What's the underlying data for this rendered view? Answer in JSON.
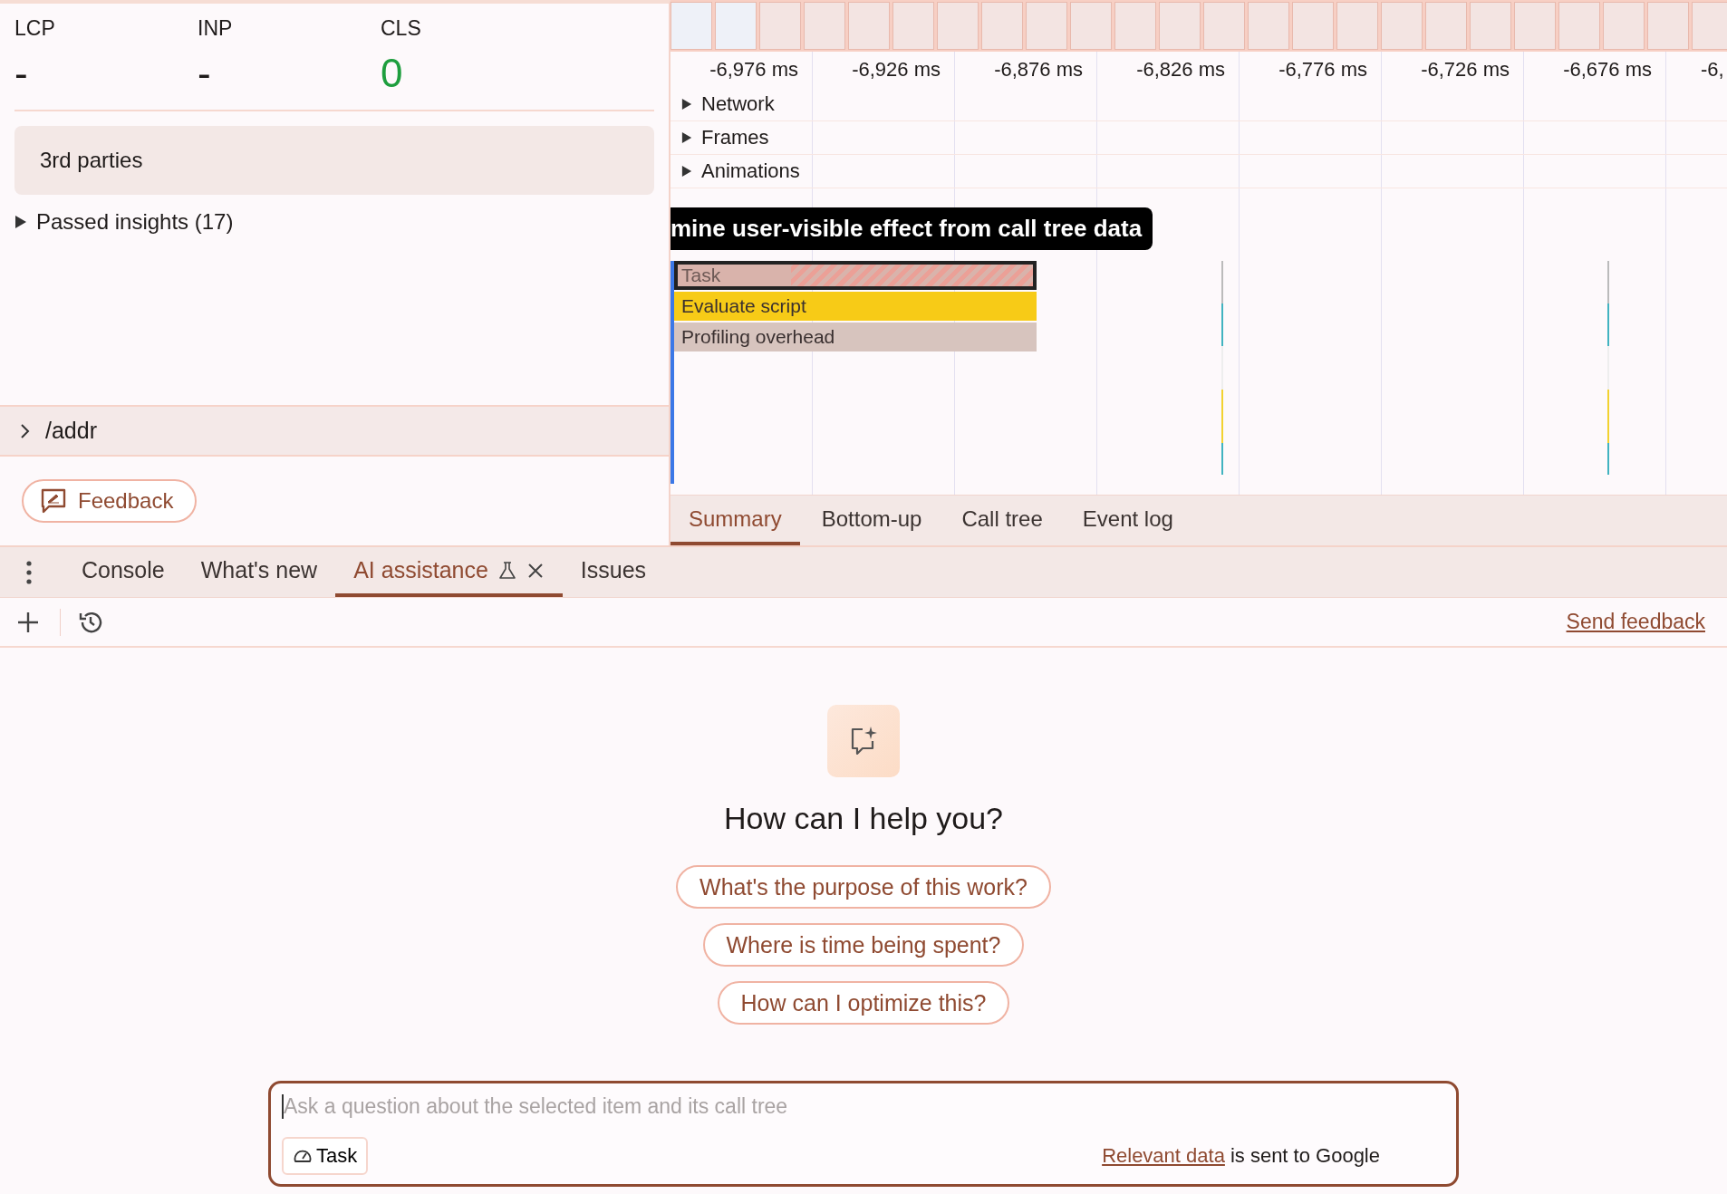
{
  "metrics": [
    {
      "label": "LCP",
      "value": "-",
      "color": "#1f1b1a"
    },
    {
      "label": "INP",
      "value": "-",
      "color": "#1f1b1a"
    },
    {
      "label": "CLS",
      "value": "0",
      "color": "#1e9e3e"
    }
  ],
  "insights": {
    "card": "3rd parties",
    "passed": {
      "label": "Passed insights (17)",
      "expanded": false
    }
  },
  "route": {
    "label": "/addr",
    "expanded": false
  },
  "feedback_button": "Feedback",
  "timeline": {
    "ticks": [
      "-6,976 ms",
      "-6,926 ms",
      "-6,876 ms",
      "-6,826 ms",
      "-6,776 ms",
      "-6,726 ms",
      "-6,676 ms",
      "-6,"
    ],
    "tracks": [
      {
        "label": "Network",
        "expanded": false
      },
      {
        "label": "Frames",
        "expanded": false
      },
      {
        "label": "Animations",
        "expanded": false
      }
    ],
    "tooltip": "mine user-visible effect from call tree data",
    "flame": [
      {
        "label": "Task",
        "kind": "task",
        "selected": true
      },
      {
        "label": "Evaluate script",
        "kind": "script",
        "selected": false
      },
      {
        "label": "Profiling overhead",
        "kind": "overhead",
        "selected": false
      }
    ]
  },
  "details_tabs": [
    {
      "label": "Summary",
      "selected": true
    },
    {
      "label": "Bottom-up",
      "selected": false
    },
    {
      "label": "Call tree",
      "selected": false
    },
    {
      "label": "Event log",
      "selected": false
    }
  ],
  "drawer": {
    "tabs": [
      {
        "label": "Console",
        "selected": false,
        "experimental": false,
        "closable": false
      },
      {
        "label": "What's new",
        "selected": false,
        "experimental": false,
        "closable": false
      },
      {
        "label": "AI assistance",
        "selected": true,
        "experimental": true,
        "closable": true
      },
      {
        "label": "Issues",
        "selected": false,
        "experimental": false,
        "closable": false
      }
    ],
    "send_feedback": "Send feedback"
  },
  "assistant": {
    "heading": "How can I help you?",
    "suggestions": [
      "What's the purpose of this work?",
      "Where is time being spent?",
      "How can I optimize this?"
    ],
    "input": {
      "placeholder": "Ask a question about the selected item and its call tree",
      "context_chip": "Task",
      "notice_link": "Relevant data",
      "notice_text": "is sent to Google"
    }
  }
}
